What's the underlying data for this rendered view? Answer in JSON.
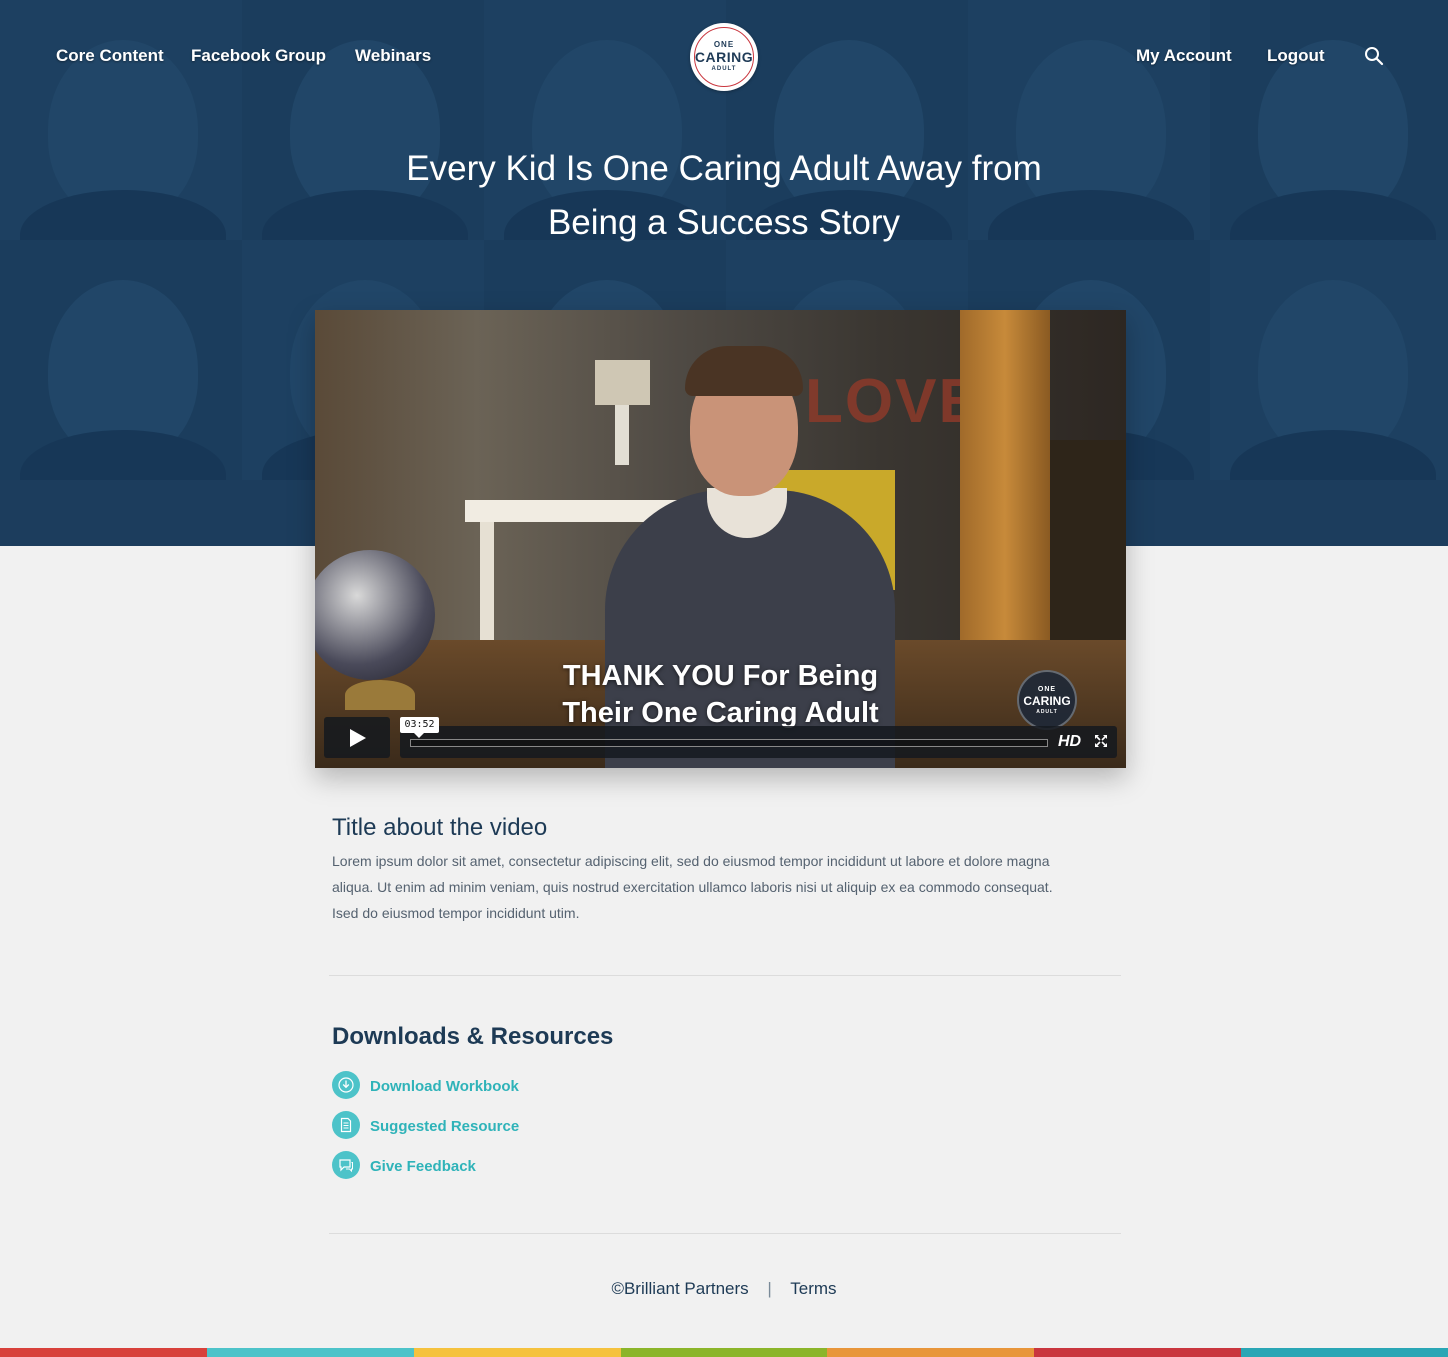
{
  "nav": {
    "left": [
      "Core Content",
      "Facebook Group",
      "Webinars"
    ],
    "right": [
      "My Account",
      "Logout"
    ]
  },
  "logo": {
    "line1": "ONE",
    "line2": "CARING",
    "line3": "ADULT"
  },
  "hero": {
    "title_line1": "Every Kid Is One Caring Adult Away from",
    "title_line2": "Being a Success Story"
  },
  "video": {
    "caption_line1": "THANK YOU For Being",
    "caption_line2": "Their One Caring Adult",
    "background_text": "LOVE",
    "time": "03:52",
    "quality": "HD",
    "badge": {
      "line1": "ONE",
      "line2": "CARING",
      "line3": "ADULT"
    },
    "progress": 0
  },
  "about": {
    "title": "Title about the video",
    "description": "Lorem ipsum dolor sit amet, consectetur adipiscing elit, sed do eiusmod tempor incididunt ut labore et dolore magna aliqua. Ut enim ad minim veniam, quis nostrud exercitation ullamco laboris nisi ut aliquip ex ea commodo consequat. Ised do eiusmod tempor incididunt utim."
  },
  "resources": {
    "title": "Downloads & Resources",
    "items": [
      {
        "label": "Download Workbook",
        "icon": "download-icon"
      },
      {
        "label": "Suggested Resource",
        "icon": "document-icon"
      },
      {
        "label": "Give Feedback",
        "icon": "chat-icon"
      }
    ]
  },
  "footer": {
    "copyright": "©Brilliant Partners",
    "separator": "|",
    "terms": "Terms"
  },
  "colors": {
    "hero": "#1d3f5e",
    "accent": "#4dc3c9",
    "link": "#2fb3b9",
    "stripe": [
      "#d8413b",
      "#4dc3c9",
      "#f5c23e",
      "#8bb52a",
      "#e8963a",
      "#c9363e",
      "#2aa6b5"
    ]
  }
}
